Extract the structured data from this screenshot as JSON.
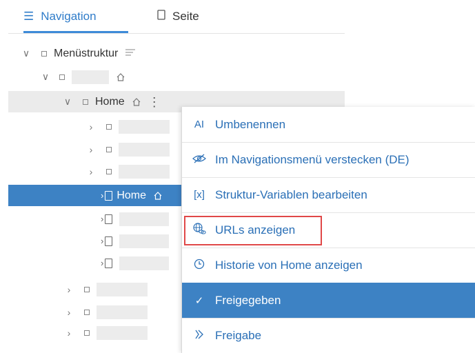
{
  "tabs": {
    "navigation_label": "Navigation",
    "page_label": "Seite",
    "navigation_icon": "list-icon",
    "page_icon": "page-icon"
  },
  "tree": {
    "menu_root_label": "Menüstruktur",
    "home_label": "Home",
    "selected_home_label": "Home"
  },
  "context_menu": {
    "items": [
      {
        "label": "Umbenennen",
        "icon": "rename-icon"
      },
      {
        "label": "Im Navigationsmenü verstecken (DE)",
        "icon": "eye-off-icon"
      },
      {
        "label": "Struktur-Variablen bearbeiten",
        "icon": "variable-icon"
      },
      {
        "label": "URLs anzeigen",
        "icon": "globe-link-icon"
      },
      {
        "label": "Historie von Home anzeigen",
        "icon": "clock-icon"
      },
      {
        "label": "Freigegeben",
        "icon": "check-icon"
      },
      {
        "label": "Freigabe",
        "icon": "release-icon"
      }
    ],
    "rename_glyph": "AI",
    "variable_glyph": "[x]"
  },
  "colors": {
    "accent": "#3d82c4",
    "highlight": "#e04747"
  }
}
